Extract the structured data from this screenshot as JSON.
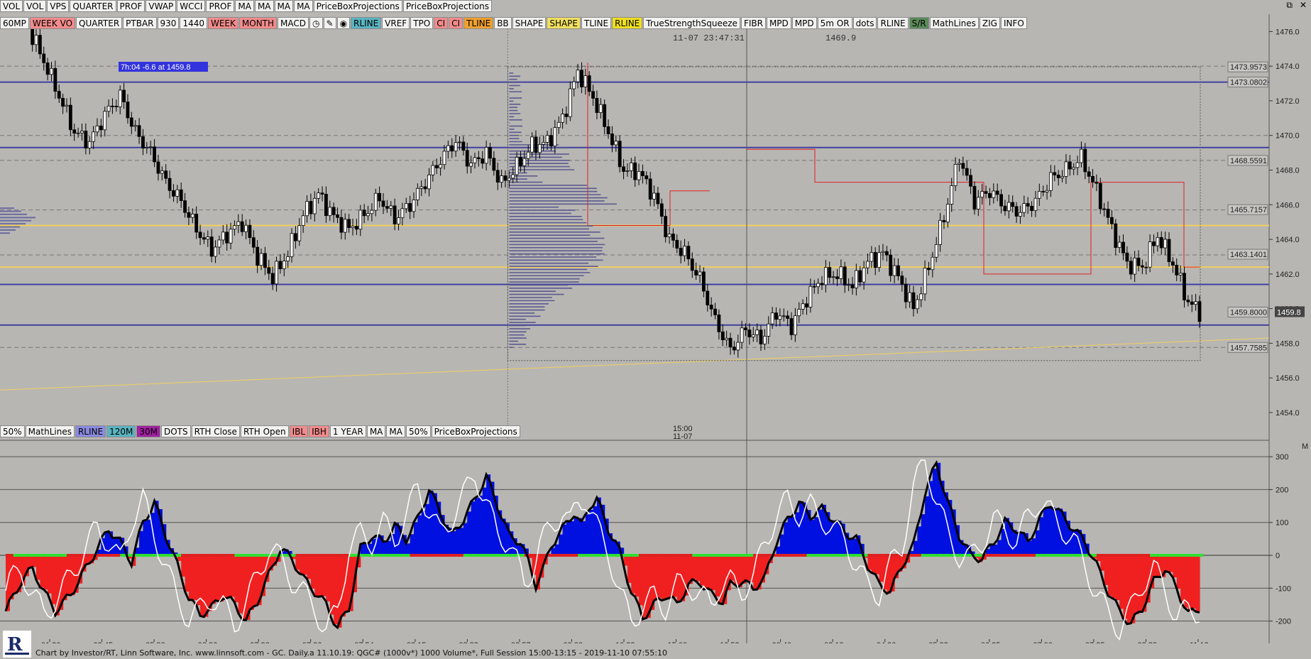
{
  "top_toolbar": [
    "VOL",
    "VOL",
    "VPS",
    "QUARTER",
    "PROF",
    "VWAP",
    "WCCI",
    "PROF",
    "MA",
    "MA",
    "MA",
    "MA",
    "PriceBoxProjections",
    "PriceBoxProjections"
  ],
  "second_toolbar": [
    {
      "label": "60MP",
      "bg": "#f2f2f0"
    },
    {
      "label": "WEEK VO",
      "bg": "#f28b8b"
    },
    {
      "label": "QUARTER",
      "bg": "#f2f2f0"
    },
    {
      "label": "PTBAR",
      "bg": "#f2f2f0"
    },
    {
      "label": "930",
      "bg": "#f2f2f0"
    },
    {
      "label": "1440",
      "bg": "#f2f2f0"
    },
    {
      "label": "WEEK",
      "bg": "#f28b8b"
    },
    {
      "label": "MONTH",
      "bg": "#f28b8b"
    },
    {
      "label": "MACD",
      "bg": "#f2f2f0"
    },
    {
      "label": "◷",
      "bg": "#f2f2f0"
    },
    {
      "label": "✎",
      "bg": "#f2f2f0"
    },
    {
      "label": "◉",
      "bg": "#f2f2f0"
    },
    {
      "label": "RLINE",
      "bg": "#5ab4c0"
    },
    {
      "label": "VREF",
      "bg": "#f2f2f0"
    },
    {
      "label": "TPO",
      "bg": "#f2f2f0"
    },
    {
      "label": "CI",
      "bg": "#f28b8b"
    },
    {
      "label": "CI",
      "bg": "#f28b8b"
    },
    {
      "label": "TLINE",
      "bg": "#f0a030"
    },
    {
      "label": "BB",
      "bg": "#f2f2f0"
    },
    {
      "label": "SHAPE",
      "bg": "#f2f2f0"
    },
    {
      "label": "SHAPE",
      "bg": "#f0e060"
    },
    {
      "label": "TLINE",
      "bg": "#f2f2f0"
    },
    {
      "label": "RLINE",
      "bg": "#f0e020"
    },
    {
      "label": "TrueStrengthSqueeze",
      "bg": "#f2f2f0"
    },
    {
      "label": "FIBR",
      "bg": "#f2f2f0"
    },
    {
      "label": "MPD",
      "bg": "#f2f2f0"
    },
    {
      "label": "MPD",
      "bg": "#f2f2f0"
    },
    {
      "label": "5m OR",
      "bg": "#f2f2f0"
    },
    {
      "label": "dots",
      "bg": "#f2f2f0"
    },
    {
      "label": "RLINE",
      "bg": "#f2f2f0"
    },
    {
      "label": "S/R",
      "bg": "#5a8a5a"
    },
    {
      "label": "MathLines",
      "bg": "#f2f2f0"
    },
    {
      "label": "ZIG",
      "bg": "#f2f2f0"
    },
    {
      "label": "INFO",
      "bg": "#f2f2f0"
    }
  ],
  "lower_toolbar": [
    {
      "label": "50%",
      "bg": "#f2f2f0"
    },
    {
      "label": "MathLines",
      "bg": "#f2f2f0"
    },
    {
      "label": "RLINE",
      "bg": "#8a8ae0"
    },
    {
      "label": "120M",
      "bg": "#5ab4c0"
    },
    {
      "label": "30M",
      "bg": "#a020a0"
    },
    {
      "label": "DOTS",
      "bg": "#f2f2f0"
    },
    {
      "label": "RTH Close",
      "bg": "#f2f2f0"
    },
    {
      "label": "RTH Open",
      "bg": "#f2f2f0"
    },
    {
      "label": "IBL",
      "bg": "#f28b8b"
    },
    {
      "label": "IBH",
      "bg": "#f28b8b"
    },
    {
      "label": "1 YEAR",
      "bg": "#f2f2f0"
    },
    {
      "label": "MA",
      "bg": "#f2f2f0"
    },
    {
      "label": "MA",
      "bg": "#f2f2f0"
    },
    {
      "label": "50%",
      "bg": "#f2f2f0"
    },
    {
      "label": "PriceBoxProjections",
      "bg": "#f2f2f0"
    }
  ],
  "window_controls": [
    "⧉",
    "✕"
  ],
  "cursor_readout": {
    "datetime": "11-07  23:47:31",
    "price": "1469.9"
  },
  "annotation_box": "7h:04  -6.6 at 1459.8",
  "session_marker": {
    "time": "15:00",
    "date": "11-07"
  },
  "corner_label": "M",
  "footer_text": "Chart by Investor/RT, Linn Software, Inc. www.linnsoft.com - GC. Daily.a     11.10.19: QGC# (1000v*) 1000 Volume*, Full Session 15:00-13:15 - 2019-11-10 07:55:10",
  "colors": {
    "background": "#b8b6b3",
    "up_candle": "#ffffff",
    "down_candle": "#000000",
    "level_line": "#4040a0",
    "yellow_line": "#f0d060",
    "red_box": "#e02020",
    "tsi_pos": "#0010e0",
    "tsi_neg": "#f02020",
    "zero_pos": "#30e030",
    "zero_neg": "#e02020"
  },
  "chart_data": [
    {
      "type": "candlestick",
      "title": "GC",
      "y_ticks": [
        1476.0,
        1474.0,
        1472.0,
        1470.0,
        1468.0,
        1466.0,
        1464.0,
        1462.0,
        1460.0,
        1458.0,
        1456.0,
        1454.0
      ],
      "ylim": [
        1453.3,
        1477.0
      ],
      "price_labels": [
        "1473.9573",
        "1473.0802",
        "1468.5591",
        "1465.7157",
        "1463.1401",
        "1459.8000",
        "1457.7585"
      ],
      "last_price": "1459.8",
      "horizontal_levels": [
        1473.08,
        1469.3,
        1461.4,
        1459.05
      ],
      "yellow_levels": [
        1464.8,
        1462.4
      ],
      "close_path": [
        [
          0,
          1478.0
        ],
        [
          5,
          1476.6
        ],
        [
          9,
          1474.8
        ],
        [
          13,
          1472.8
        ],
        [
          18,
          1470.2
        ],
        [
          22,
          1469.6
        ],
        [
          26,
          1471.2
        ],
        [
          30,
          1472.3
        ],
        [
          34,
          1470.2
        ],
        [
          38,
          1469.0
        ],
        [
          42,
          1467.3
        ],
        [
          46,
          1466.2
        ],
        [
          50,
          1464.6
        ],
        [
          54,
          1463.4
        ],
        [
          58,
          1464.3
        ],
        [
          62,
          1465.0
        ],
        [
          66,
          1463.0
        ],
        [
          70,
          1461.8
        ],
        [
          74,
          1463.2
        ],
        [
          78,
          1465.4
        ],
        [
          82,
          1466.6
        ],
        [
          86,
          1465.3
        ],
        [
          90,
          1464.6
        ],
        [
          94,
          1465.4
        ],
        [
          98,
          1466.4
        ],
        [
          102,
          1465.2
        ],
        [
          106,
          1466.0
        ],
        [
          110,
          1467.3
        ],
        [
          114,
          1468.6
        ],
        [
          118,
          1469.7
        ],
        [
          122,
          1468.3
        ],
        [
          126,
          1469.0
        ],
        [
          130,
          1467.2
        ],
        [
          134,
          1468.2
        ],
        [
          138,
          1469.4
        ],
        [
          142,
          1469.6
        ],
        [
          146,
          1471.0
        ],
        [
          150,
          1473.7
        ],
        [
          154,
          1472.2
        ],
        [
          158,
          1470.2
        ],
        [
          162,
          1468.0
        ],
        [
          166,
          1467.9
        ],
        [
          170,
          1466.5
        ],
        [
          174,
          1464.0
        ],
        [
          178,
          1463.2
        ],
        [
          182,
          1461.7
        ],
        [
          186,
          1459.3
        ],
        [
          190,
          1457.6
        ],
        [
          194,
          1458.8
        ],
        [
          198,
          1458.2
        ],
        [
          202,
          1459.8
        ],
        [
          206,
          1459.0
        ],
        [
          210,
          1460.6
        ],
        [
          214,
          1461.8
        ],
        [
          218,
          1462.0
        ],
        [
          222,
          1461.3
        ],
        [
          226,
          1462.7
        ],
        [
          230,
          1463.2
        ],
        [
          234,
          1461.8
        ],
        [
          238,
          1460.0
        ],
        [
          242,
          1462.4
        ],
        [
          246,
          1465.3
        ],
        [
          250,
          1468.8
        ],
        [
          254,
          1466.2
        ],
        [
          258,
          1466.8
        ],
        [
          262,
          1465.9
        ],
        [
          266,
          1465.6
        ],
        [
          270,
          1466.2
        ],
        [
          274,
          1467.5
        ],
        [
          278,
          1468.0
        ],
        [
          282,
          1468.7
        ],
        [
          286,
          1466.8
        ],
        [
          290,
          1464.6
        ],
        [
          294,
          1462.6
        ],
        [
          298,
          1462.4
        ],
        [
          302,
          1464.2
        ],
        [
          306,
          1462.6
        ],
        [
          310,
          1460.4
        ],
        [
          313,
          1459.8
        ]
      ],
      "volume_profile_start_index": 132,
      "x_axis_labels": [
        "01:30",
        "03:45",
        "05:36",
        "06:36",
        "07:26",
        "07:36",
        "07:54",
        "08:15",
        "08:38",
        "08:57",
        "09:30",
        "10:33",
        "15:00",
        "19:53",
        "00:40",
        "03:19",
        "04:26",
        "05:22",
        "06:25",
        "07:00",
        "07:25",
        "08:38",
        "11:12"
      ]
    },
    {
      "type": "area",
      "title": "TrueStrengthSqueeze",
      "y_ticks": [
        300,
        200,
        100,
        0,
        -100,
        -200
      ],
      "ylim": [
        -255,
        350
      ],
      "series_points": [
        [
          0,
          -170
        ],
        [
          4,
          -80
        ],
        [
          7,
          -40
        ],
        [
          10,
          -110
        ],
        [
          13,
          -170
        ],
        [
          17,
          -120
        ],
        [
          21,
          -40
        ],
        [
          24,
          20
        ],
        [
          27,
          80
        ],
        [
          30,
          40
        ],
        [
          33,
          -20
        ],
        [
          36,
          100
        ],
        [
          39,
          160
        ],
        [
          42,
          60
        ],
        [
          45,
          -30
        ],
        [
          48,
          -130
        ],
        [
          51,
          -180
        ],
        [
          54,
          -160
        ],
        [
          57,
          -120
        ],
        [
          60,
          -150
        ],
        [
          63,
          -200
        ],
        [
          66,
          -140
        ],
        [
          69,
          -60
        ],
        [
          72,
          20
        ],
        [
          75,
          -10
        ],
        [
          78,
          -70
        ],
        [
          81,
          -110
        ],
        [
          84,
          -150
        ],
        [
          87,
          -220
        ],
        [
          90,
          -160
        ],
        [
          93,
          20
        ],
        [
          96,
          60
        ],
        [
          99,
          40
        ],
        [
          102,
          90
        ],
        [
          105,
          50
        ],
        [
          108,
          110
        ],
        [
          111,
          200
        ],
        [
          114,
          130
        ],
        [
          117,
          60
        ],
        [
          120,
          110
        ],
        [
          123,
          170
        ],
        [
          126,
          240
        ],
        [
          129,
          150
        ],
        [
          132,
          60
        ],
        [
          135,
          40
        ],
        [
          137,
          -20
        ],
        [
          139,
          -90
        ],
        [
          141,
          -40
        ],
        [
          143,
          30
        ],
        [
          146,
          80
        ],
        [
          149,
          130
        ],
        [
          151,
          90
        ],
        [
          153,
          150
        ],
        [
          155,
          170
        ],
        [
          158,
          80
        ],
        [
          161,
          10
        ],
        [
          164,
          -110
        ],
        [
          167,
          -190
        ],
        [
          170,
          -150
        ],
        [
          173,
          -120
        ],
        [
          176,
          -150
        ],
        [
          179,
          -90
        ],
        [
          182,
          -80
        ],
        [
          185,
          -120
        ],
        [
          188,
          -140
        ],
        [
          190,
          -90
        ],
        [
          193,
          -80
        ],
        [
          196,
          -100
        ],
        [
          199,
          -70
        ],
        [
          202,
          40
        ],
        [
          205,
          110
        ],
        [
          208,
          160
        ],
        [
          211,
          120
        ],
        [
          214,
          140
        ],
        [
          217,
          110
        ],
        [
          220,
          70
        ],
        [
          223,
          50
        ],
        [
          226,
          -30
        ],
        [
          229,
          -90
        ],
        [
          232,
          -110
        ],
        [
          235,
          -30
        ],
        [
          238,
          30
        ],
        [
          241,
          190
        ],
        [
          244,
          280
        ],
        [
          247,
          160
        ],
        [
          250,
          60
        ],
        [
          253,
          0
        ],
        [
          256,
          -10
        ],
        [
          259,
          40
        ],
        [
          262,
          100
        ],
        [
          265,
          80
        ],
        [
          268,
          40
        ],
        [
          271,
          110
        ],
        [
          274,
          160
        ],
        [
          277,
          120
        ],
        [
          280,
          80
        ],
        [
          283,
          40
        ],
        [
          286,
          -30
        ],
        [
          289,
          -110
        ],
        [
          292,
          -170
        ],
        [
          295,
          -210
        ],
        [
          298,
          -160
        ],
        [
          301,
          -80
        ],
        [
          304,
          -40
        ],
        [
          307,
          -100
        ],
        [
          310,
          -180
        ],
        [
          313,
          -160
        ]
      ],
      "x_axis_labels": [
        "01:30",
        "03:45",
        "05:36",
        "06:36",
        "07:26",
        "07:36",
        "07:54",
        "08:15",
        "08:38",
        "08:57",
        "09:30",
        "10:33",
        "15:00",
        "19:53",
        "00:40",
        "03:19",
        "04:26",
        "05:22",
        "06:25",
        "07:00",
        "07:25",
        "08:38",
        "11:12"
      ]
    }
  ]
}
